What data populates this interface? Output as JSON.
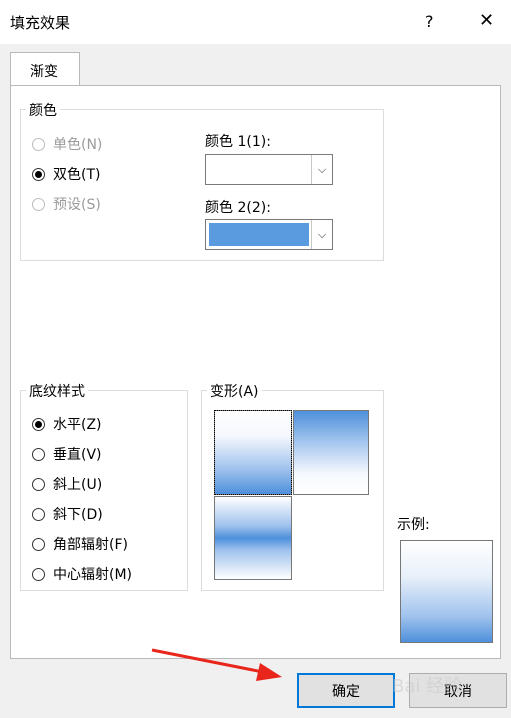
{
  "window": {
    "title": "填充效果",
    "help": "?",
    "close": "✕"
  },
  "tabs": [
    {
      "label": "渐变"
    }
  ],
  "colors_group": {
    "legend": "颜色",
    "options": [
      {
        "label": "单色(N)",
        "state": "disabled"
      },
      {
        "label": "双色(T)",
        "state": "selected"
      },
      {
        "label": "预设(S)",
        "state": "disabled"
      }
    ],
    "color1_label": "颜色 1(1):",
    "color2_label": "颜色 2(2):",
    "color2_value": "#5a9be0"
  },
  "texture_group": {
    "legend": "底纹样式",
    "options": [
      {
        "label": "水平(Z)",
        "selected": true
      },
      {
        "label": "垂直(V)",
        "selected": false
      },
      {
        "label": "斜上(U)",
        "selected": false
      },
      {
        "label": "斜下(D)",
        "selected": false
      },
      {
        "label": "角部辐射(F)",
        "selected": false
      },
      {
        "label": "中心辐射(M)",
        "selected": false
      }
    ]
  },
  "variants_group": {
    "legend": "变形(A)",
    "selected_index": 0
  },
  "sample_label": "示例:",
  "buttons": {
    "ok": "确定",
    "cancel": "取消"
  },
  "watermark": "Bai 经验"
}
